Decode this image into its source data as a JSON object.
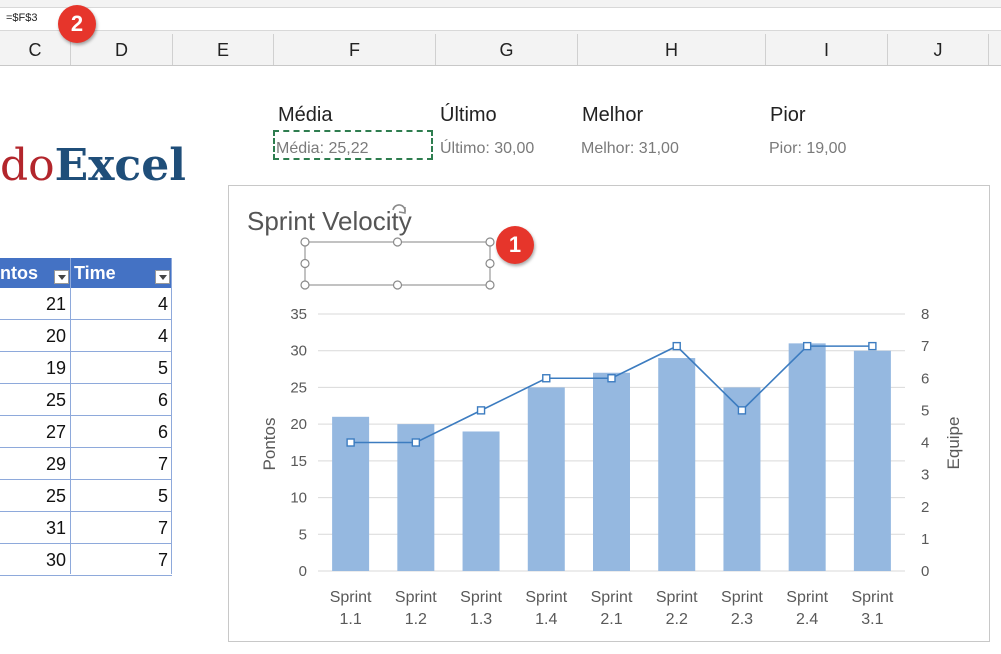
{
  "formula_bar": {
    "value": "=$F$3"
  },
  "columns": [
    "C",
    "D",
    "E",
    "F",
    "G",
    "H",
    "I",
    "J"
  ],
  "badges": {
    "one": "1",
    "two": "2"
  },
  "stats": {
    "media": {
      "label": "Média",
      "value": "Média: 25,22"
    },
    "ultimo": {
      "label": "Último",
      "value": "Último: 30,00"
    },
    "melhor": {
      "label": "Melhor",
      "value": "Melhor: 31,00"
    },
    "pior": {
      "label": "Pior",
      "value": "Pior: 19,00"
    }
  },
  "logo": {
    "prefix": "do",
    "suffix": "Excel"
  },
  "table": {
    "headers": [
      "ntos",
      "Time"
    ],
    "rows": [
      [
        "21",
        "4"
      ],
      [
        "20",
        "4"
      ],
      [
        "19",
        "5"
      ],
      [
        "25",
        "6"
      ],
      [
        "27",
        "6"
      ],
      [
        "29",
        "7"
      ],
      [
        "25",
        "5"
      ],
      [
        "31",
        "7"
      ],
      [
        "30",
        "7"
      ]
    ]
  },
  "colors": {
    "bar": "#95b8e0",
    "line": "#3c7cc0",
    "header_blue": "#4472c4",
    "badge_red": "#e6352b"
  },
  "chart_data": {
    "type": "bar",
    "title": "Sprint Velocity",
    "categories": [
      [
        "Sprint",
        "1.1"
      ],
      [
        "Sprint",
        "1.2"
      ],
      [
        "Sprint",
        "1.3"
      ],
      [
        "Sprint",
        "1.4"
      ],
      [
        "Sprint",
        "2.1"
      ],
      [
        "Sprint",
        "2.2"
      ],
      [
        "Sprint",
        "2.3"
      ],
      [
        "Sprint",
        "2.4"
      ],
      [
        "Sprint",
        "3.1"
      ]
    ],
    "series": [
      {
        "name": "Pontos",
        "type": "bar",
        "axis": "left",
        "values": [
          21,
          20,
          19,
          25,
          27,
          29,
          25,
          31,
          30
        ]
      },
      {
        "name": "Time",
        "type": "line",
        "axis": "right",
        "values": [
          4,
          4,
          5,
          6,
          6,
          7,
          5,
          7,
          7
        ]
      }
    ],
    "ylabel": "Pontos",
    "y2label": "Equipe",
    "ylim": [
      0,
      35
    ],
    "y2lim": [
      0,
      8
    ],
    "yticks": [
      0,
      5,
      10,
      15,
      20,
      25,
      30,
      35
    ],
    "y2ticks": [
      0,
      1,
      2,
      3,
      4,
      5,
      6,
      7,
      8
    ],
    "grid": true
  }
}
